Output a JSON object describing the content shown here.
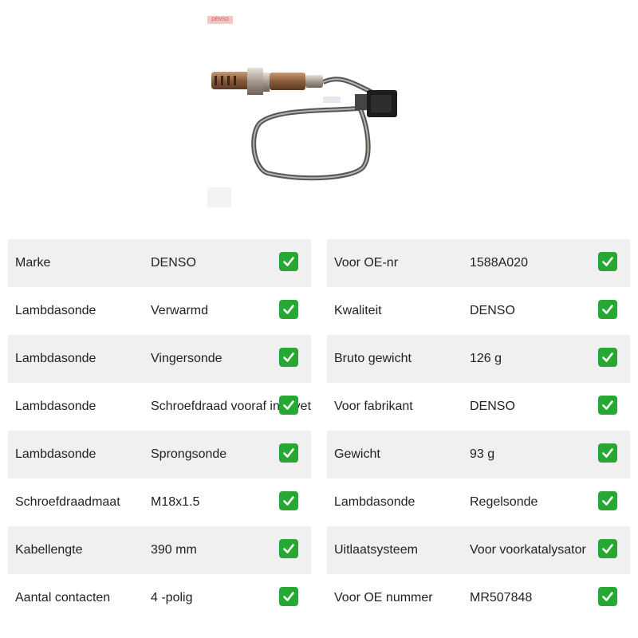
{
  "product": {
    "image_icon": "oxygen-sensor-photo",
    "brand_mark": "DENSO"
  },
  "colors": {
    "row_shade": "#f0f0f0",
    "check_green": "#27a834"
  },
  "specs_left": [
    {
      "label": "Marke",
      "value": "DENSO"
    },
    {
      "label": "Lambdasonde",
      "value": "Verwarmd"
    },
    {
      "label": "Lambdasonde",
      "value": "Vingersonde"
    },
    {
      "label": "Lambdasonde",
      "value": "Schroefdraad vooraf ingevet"
    },
    {
      "label": "Lambdasonde",
      "value": "Sprongsonde"
    },
    {
      "label": "Schroefdraadmaat",
      "value": "M18x1.5"
    },
    {
      "label": "Kabellengte",
      "value": "390 mm"
    },
    {
      "label": "Aantal contacten",
      "value": "4 -polig"
    }
  ],
  "specs_right": [
    {
      "label": "Voor OE-nr",
      "value": "1588A020"
    },
    {
      "label": "Kwaliteit",
      "value": "DENSO"
    },
    {
      "label": "Bruto gewicht",
      "value": "126 g"
    },
    {
      "label": "Voor fabrikant",
      "value": "DENSO"
    },
    {
      "label": "Gewicht",
      "value": "93 g"
    },
    {
      "label": "Lambdasonde",
      "value": "Regelsonde"
    },
    {
      "label": "Uitlaatsysteem",
      "value": "Voor voorkatalysator"
    },
    {
      "label": "Voor OE nummer",
      "value": "MR507848"
    }
  ],
  "check_icon": "check-mark-icon"
}
